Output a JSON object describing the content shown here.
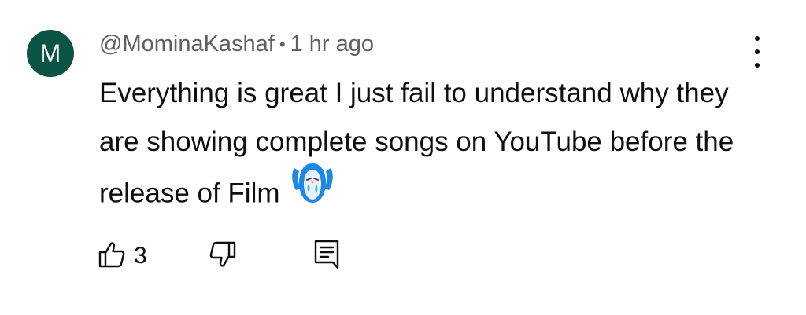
{
  "comment": {
    "avatar_letter": "M",
    "avatar_color": "#0b5345",
    "author": "@MominaKashaf",
    "separator": "•",
    "timestamp": "1 hr ago",
    "text": "Everything is great I just fail to understand why they are showing complete songs on YouTube before the release of Film",
    "emoji_icon": "crying-face-icon",
    "likes": "3"
  },
  "actions": {
    "like_icon": "thumbs-up-icon",
    "dislike_icon": "thumbs-down-icon",
    "reply_icon": "reply-comment-icon",
    "menu_icon": "more-vertical-icon"
  }
}
